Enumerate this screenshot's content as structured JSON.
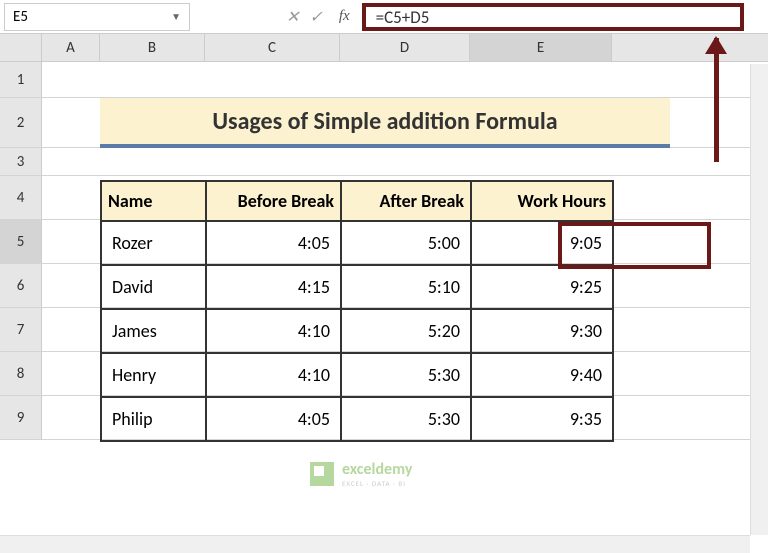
{
  "nameBox": "E5",
  "formula": "=C5+D5",
  "columns": [
    "A",
    "B",
    "C",
    "D",
    "E"
  ],
  "rowNums": [
    "1",
    "2",
    "3",
    "4",
    "5",
    "6",
    "7",
    "8",
    "9"
  ],
  "title": "Usages of Simple addition Formula",
  "headers": {
    "name": "Name",
    "before": "Before Break",
    "after": "After Break",
    "work": "Work Hours"
  },
  "data": [
    {
      "name": "Rozer",
      "before": "4:05",
      "after": "5:00",
      "work": "9:05"
    },
    {
      "name": "David",
      "before": "4:15",
      "after": "5:10",
      "work": "9:25"
    },
    {
      "name": "James",
      "before": "4:10",
      "after": "5:20",
      "work": "9:30"
    },
    {
      "name": "Henry",
      "before": "4:10",
      "after": "5:30",
      "work": "9:40"
    },
    {
      "name": "Philip",
      "before": "4:05",
      "after": "5:30",
      "work": "9:35"
    }
  ],
  "watermark": {
    "brand": "exceldemy",
    "sub": "EXCEL · DATA · BI"
  },
  "fx": {
    "cancel": "✕",
    "enter": "✓",
    "fx": "fx"
  }
}
